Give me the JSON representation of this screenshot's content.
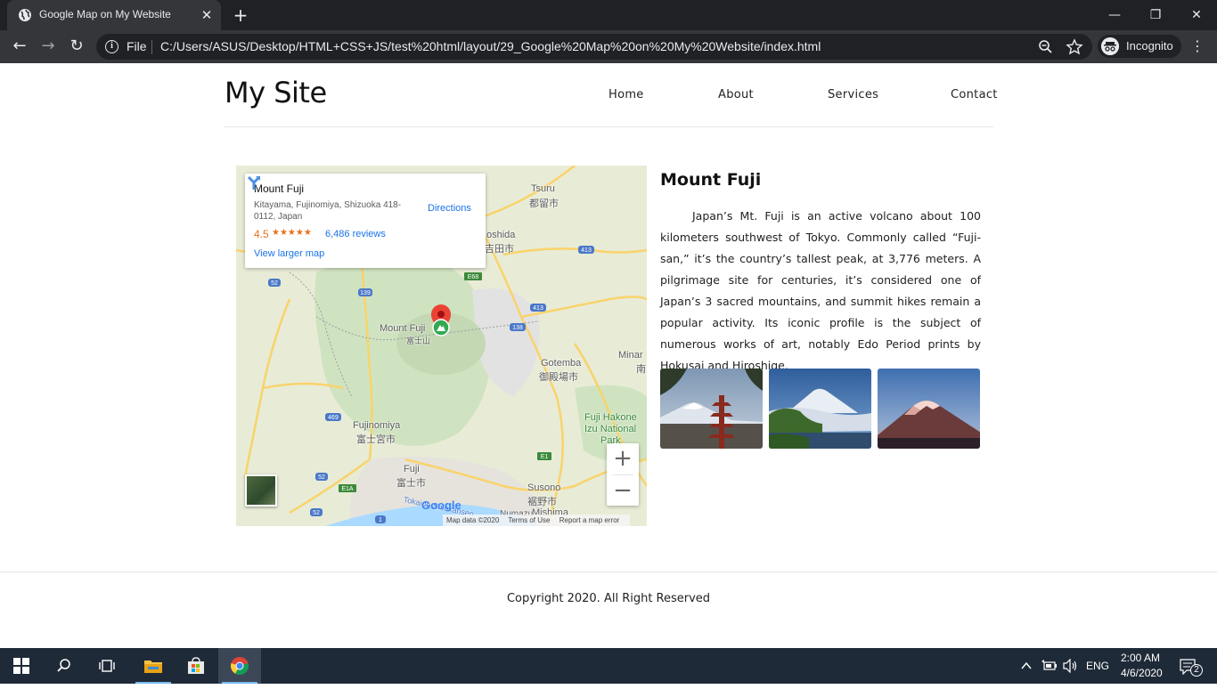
{
  "browser": {
    "tab_title": "Google Map on My Website",
    "tab_close": "✕",
    "new_tab": "+",
    "window_controls": {
      "minimize": "—",
      "restore": "❐",
      "close": "✕"
    },
    "nav": {
      "back": "←",
      "forward": "→",
      "reload": "↻"
    },
    "omnibox": {
      "scheme_label": "File",
      "url": "C:/Users/ASUS/Desktop/HTML+CSS+JS/test%20html/layout/29_Google%20Map%20on%20My%20Website/index.html",
      "zoom_icon": "zoom-out-icon",
      "bookmark_icon": "star-icon"
    },
    "profile_label": "Incognito",
    "menu": "⋮"
  },
  "site": {
    "title": "My Site",
    "nav": [
      "Home",
      "About",
      "Services",
      "Contact"
    ]
  },
  "map": {
    "place_name": "Mount Fuji",
    "address": "Kitayama, Fujinomiya, Shizuoka 418-0112, Japan",
    "rating": "4.5",
    "stars": "★★★★★",
    "reviews": "6,486 reviews",
    "larger_map": "View larger map",
    "directions": "Directions",
    "zoom_in": "+",
    "zoom_out": "−",
    "google": "Google",
    "attribution": [
      "Map data ©2020",
      "Terms of Use",
      "Report a map error"
    ],
    "labels": {
      "tsuru": "Tsuru",
      "tsuru_jp": "都留市",
      "yoshida": "oshida",
      "yoshida_jp": "吉田市",
      "mount_fuji": "Mount Fuji",
      "mount_fuji_jp": "富士山",
      "gotemba": "Gotemba",
      "gotemba_jp": "御殿場市",
      "minami": "Minar",
      "minami_jp": "南",
      "fujinomiya": "Fujinomiya",
      "fujinomiya_jp": "富士宮市",
      "fuji": "Fuji",
      "fuji_jp": "富士市",
      "hakone": "Fuji Hakone",
      "hakone2": "Izu National",
      "hakone3": "Park",
      "susono": "Susono",
      "susono_jp": "裾野市",
      "mishima": "Mishima",
      "numazu": "Numazu",
      "shinkansen": "Tokaido Shinkansen"
    },
    "road_shields": [
      "52",
      "139",
      "E68",
      "413",
      "138",
      "413",
      "469",
      "E1",
      "E1A",
      "52",
      "52",
      "1"
    ]
  },
  "article": {
    "title": "Mount Fuji",
    "body": "Japan’s Mt. Fuji is an active volcano about 100 kilometers southwest of Tokyo. Commonly called “Fuji-san,” it’s the country’s tallest peak, at 3,776 meters. A pilgrimage site for centuries, it’s considered one of Japan’s 3 sacred mountains, and summit hikes remain a popular activity. Its iconic profile is the subject of numerous works of art, notably Edo Period prints by Hokusai and Hiroshige."
  },
  "footer": {
    "copyright": "Copyright 2020. All Right Reserved"
  },
  "taskbar": {
    "input_lang": "ENG",
    "time": "2:00 AM",
    "date": "4/6/2020",
    "notification_count": "2"
  },
  "colors": {
    "chrome_frame": "#202124",
    "chrome_toolbar": "#35363a",
    "map_land": "#e8ecd6",
    "map_park": "#cfe3c1",
    "map_road": "#f9d36b",
    "link_blue": "#1a73e8",
    "rating_orange": "#e7711b",
    "taskbar": "#1f2a38"
  }
}
